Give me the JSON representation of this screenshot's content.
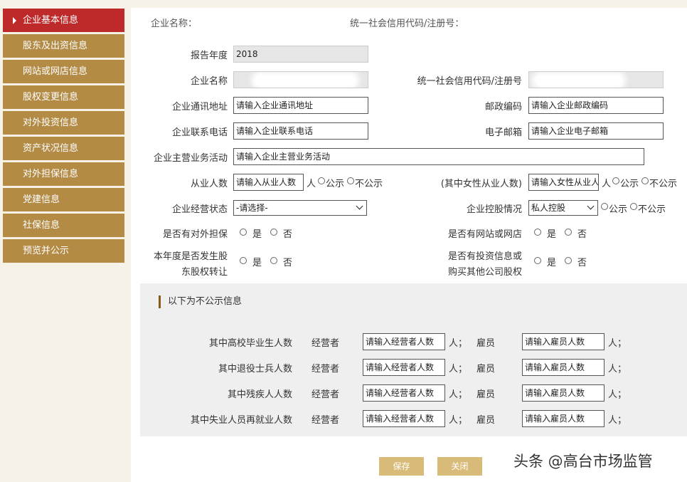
{
  "sidebar": {
    "items": [
      {
        "label": "企业基本信息"
      },
      {
        "label": "股东及出资信息"
      },
      {
        "label": "网站或网店信息"
      },
      {
        "label": "股权变更信息"
      },
      {
        "label": "对外投资信息"
      },
      {
        "label": "资产状况信息"
      },
      {
        "label": "对外担保信息"
      },
      {
        "label": "党建信息"
      },
      {
        "label": "社保信息"
      },
      {
        "label": "预览并公示"
      }
    ]
  },
  "header": {
    "company_name_label": "企业名称：",
    "credit_code_label": "统一社会信用代码/注册号："
  },
  "form": {
    "report_year_label": "报告年度",
    "report_year_value": "2018",
    "company_name_label": "企业名称",
    "credit_code_label": "统一社会信用代码/注册号",
    "address_label": "企业通讯地址",
    "address_placeholder": "请输入企业通讯地址",
    "postal_label": "邮政编码",
    "postal_placeholder": "请输入企业邮政编码",
    "phone_label": "企业联系电话",
    "phone_placeholder": "请输入企业联系电话",
    "email_label": "电子邮箱",
    "email_placeholder": "请输入企业电子邮箱",
    "business_label": "企业主营业务活动",
    "business_placeholder": "请输入企业主营业务活动",
    "employees_label": "从业人数",
    "employees_placeholder": "请输入从业人数",
    "unit_person": "人",
    "public_label": "公示",
    "not_public_label": "不公示",
    "female_label": "(其中女性从业人数)",
    "female_placeholder": "请输入女性从业人数",
    "status_label": "企业经营状态",
    "status_value": "-请选择-",
    "holding_label": "企业控股情况",
    "holding_value": "私人控股",
    "guarantee_label": "是否有对外担保",
    "website_label": "是否有网站或网店",
    "equity_label_1": "本年度是否发生股",
    "equity_label_2": "东股权转让",
    "invest_label_1": "是否有投资信息或",
    "invest_label_2": "购买其他公司股权",
    "yes_label": "是",
    "no_label": "否"
  },
  "private_section": {
    "title": "以下为不公示信息",
    "operator_label": "经营者",
    "employee_label": "雇员",
    "operator_placeholder": "请输入经营者人数",
    "employee_placeholder": "请输入雇员人数",
    "unit_sep": "人；",
    "rows": [
      {
        "label": "其中高校毕业生人数"
      },
      {
        "label": "其中退役士兵人数"
      },
      {
        "label": "其中残疾人人数"
      },
      {
        "label": "其中失业人员再就业人数"
      }
    ]
  },
  "buttons": {
    "save": "保存",
    "close": "关闭"
  },
  "watermark": "头条 @高台市场监管",
  "colors": {
    "sidebar_bg": "#b38b45",
    "sidebar_active": "#be2a2a",
    "button_bg": "#d9bb79",
    "page_bg": "#f7f2e8"
  }
}
